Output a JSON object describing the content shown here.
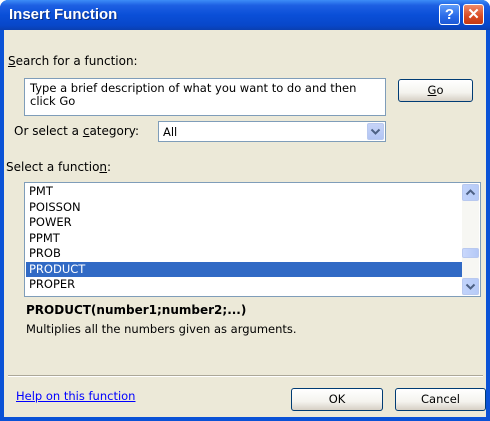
{
  "dialog": {
    "title": "Insert Function",
    "help_button_label": "?",
    "close_button_label": "✕"
  },
  "search": {
    "label_prefix": "",
    "label_access_key": "S",
    "label_rest": "earch for a function:",
    "input_value_line1": "Type a brief description of what you want to do and then",
    "input_value_line2": "click Go",
    "go_button_access_key": "G",
    "go_button_rest": "o"
  },
  "category": {
    "label_prefix": "Or select a ",
    "label_access_key": "c",
    "label_rest": "ategory:",
    "selected_value": "All"
  },
  "functions": {
    "label_prefix": "Select a functio",
    "label_access_key": "n",
    "label_rest": ":",
    "items": [
      {
        "name": "PMT",
        "selected": false
      },
      {
        "name": "POISSON",
        "selected": false
      },
      {
        "name": "POWER",
        "selected": false
      },
      {
        "name": "PPMT",
        "selected": false
      },
      {
        "name": "PROB",
        "selected": false
      },
      {
        "name": "PRODUCT",
        "selected": true
      },
      {
        "name": "PROPER",
        "selected": false
      }
    ]
  },
  "selected_function": {
    "signature": "PRODUCT(number1;number2;...)",
    "description": "Multiplies all the numbers given as arguments."
  },
  "footer": {
    "help_link": "Help on this function",
    "ok_label": "OK",
    "cancel_label": "Cancel"
  },
  "colors": {
    "title_bar": "#0a4fd8",
    "dialog_face": "#ece9d8",
    "selection": "#316ac5",
    "link": "#0000ff"
  },
  "icons": {
    "help": "question-mark-icon",
    "close": "close-icon",
    "dropdown": "chevron-down-icon",
    "scroll_up": "scroll-up-arrow-icon",
    "scroll_down": "scroll-down-arrow-icon"
  }
}
